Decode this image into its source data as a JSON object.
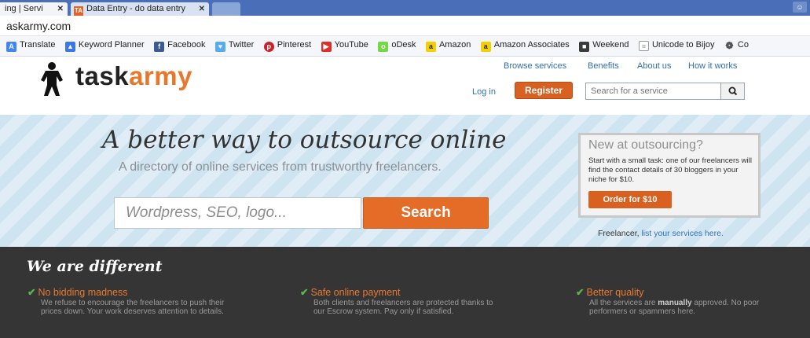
{
  "browser": {
    "tabs": [
      {
        "label": "ing | Servi"
      },
      {
        "label": "Data Entry - do data entry"
      }
    ],
    "tab_close": "✕",
    "url": "askarmy.com",
    "bookmarks": [
      {
        "label": "Translate",
        "icon": "translate-icon",
        "color": "#4285f4"
      },
      {
        "label": "Keyword Planner",
        "icon": "adwords-icon",
        "color": "#3b78e7"
      },
      {
        "label": "Facebook",
        "icon": "facebook-icon",
        "color": "#3b5998"
      },
      {
        "label": "Twitter",
        "icon": "twitter-icon",
        "color": "#55acee"
      },
      {
        "label": "Pinterest",
        "icon": "pinterest-icon",
        "color": "#cb2027"
      },
      {
        "label": "YouTube",
        "icon": "youtube-icon",
        "color": "#e52d27"
      },
      {
        "label": "oDesk",
        "icon": "odesk-icon",
        "color": "#6fda44"
      },
      {
        "label": "Amazon",
        "icon": "amazon-icon",
        "color": "#222222"
      },
      {
        "label": "Amazon Associates",
        "icon": "amazon-icon",
        "color": "#222222"
      },
      {
        "label": "Weekend",
        "icon": "weekend-icon",
        "color": "#3a3a3a"
      },
      {
        "label": "Unicode to Bijoy",
        "icon": "page-icon",
        "color": "#ffffff"
      },
      {
        "label": "Co",
        "icon": "settings-icon",
        "color": "#666666"
      }
    ]
  },
  "site": {
    "logo": {
      "part1": "task",
      "part2": "army"
    },
    "nav": {
      "browse": "Browse services",
      "benefits": "Benefits",
      "about": "About us",
      "how": "How it works"
    },
    "login": "Log in",
    "register": "Register",
    "search_placeholder": "Search for a service"
  },
  "hero": {
    "title": "A better way to outsource online",
    "subtitle": "A directory of online services from trustworthy freelancers.",
    "search_placeholder": "Wordpress, SEO, logo...",
    "search_button": "Search",
    "promo": {
      "title": "New at outsourcing?",
      "text": "Start with a small task: one of our freelancers will find the contact details of 30 bloggers in your niche for $10.",
      "button": "Order for $10"
    },
    "freelancer_prefix": "Freelancer,",
    "freelancer_link": "list your services here."
  },
  "different": {
    "title": "We are different",
    "features": [
      {
        "title": "No bidding madness",
        "body": "We refuse to encourage the freelancers to push their prices down. Your work deserves attention to details."
      },
      {
        "title": "Safe online payment",
        "body": "Both clients and freelancers are protected thanks to our Escrow system. Pay only if satisfied."
      },
      {
        "title": "Better quality",
        "body_pre": "All the services are",
        "body_bold": "manually",
        "body_post": "approved. No poor performers or spammers here."
      }
    ]
  },
  "colors": {
    "brand_orange": "#e8772c",
    "link_blue": "#2f6fb5",
    "hero_bg": "#cfe4f1",
    "dark_band": "#353535",
    "check_green": "#58b848"
  }
}
